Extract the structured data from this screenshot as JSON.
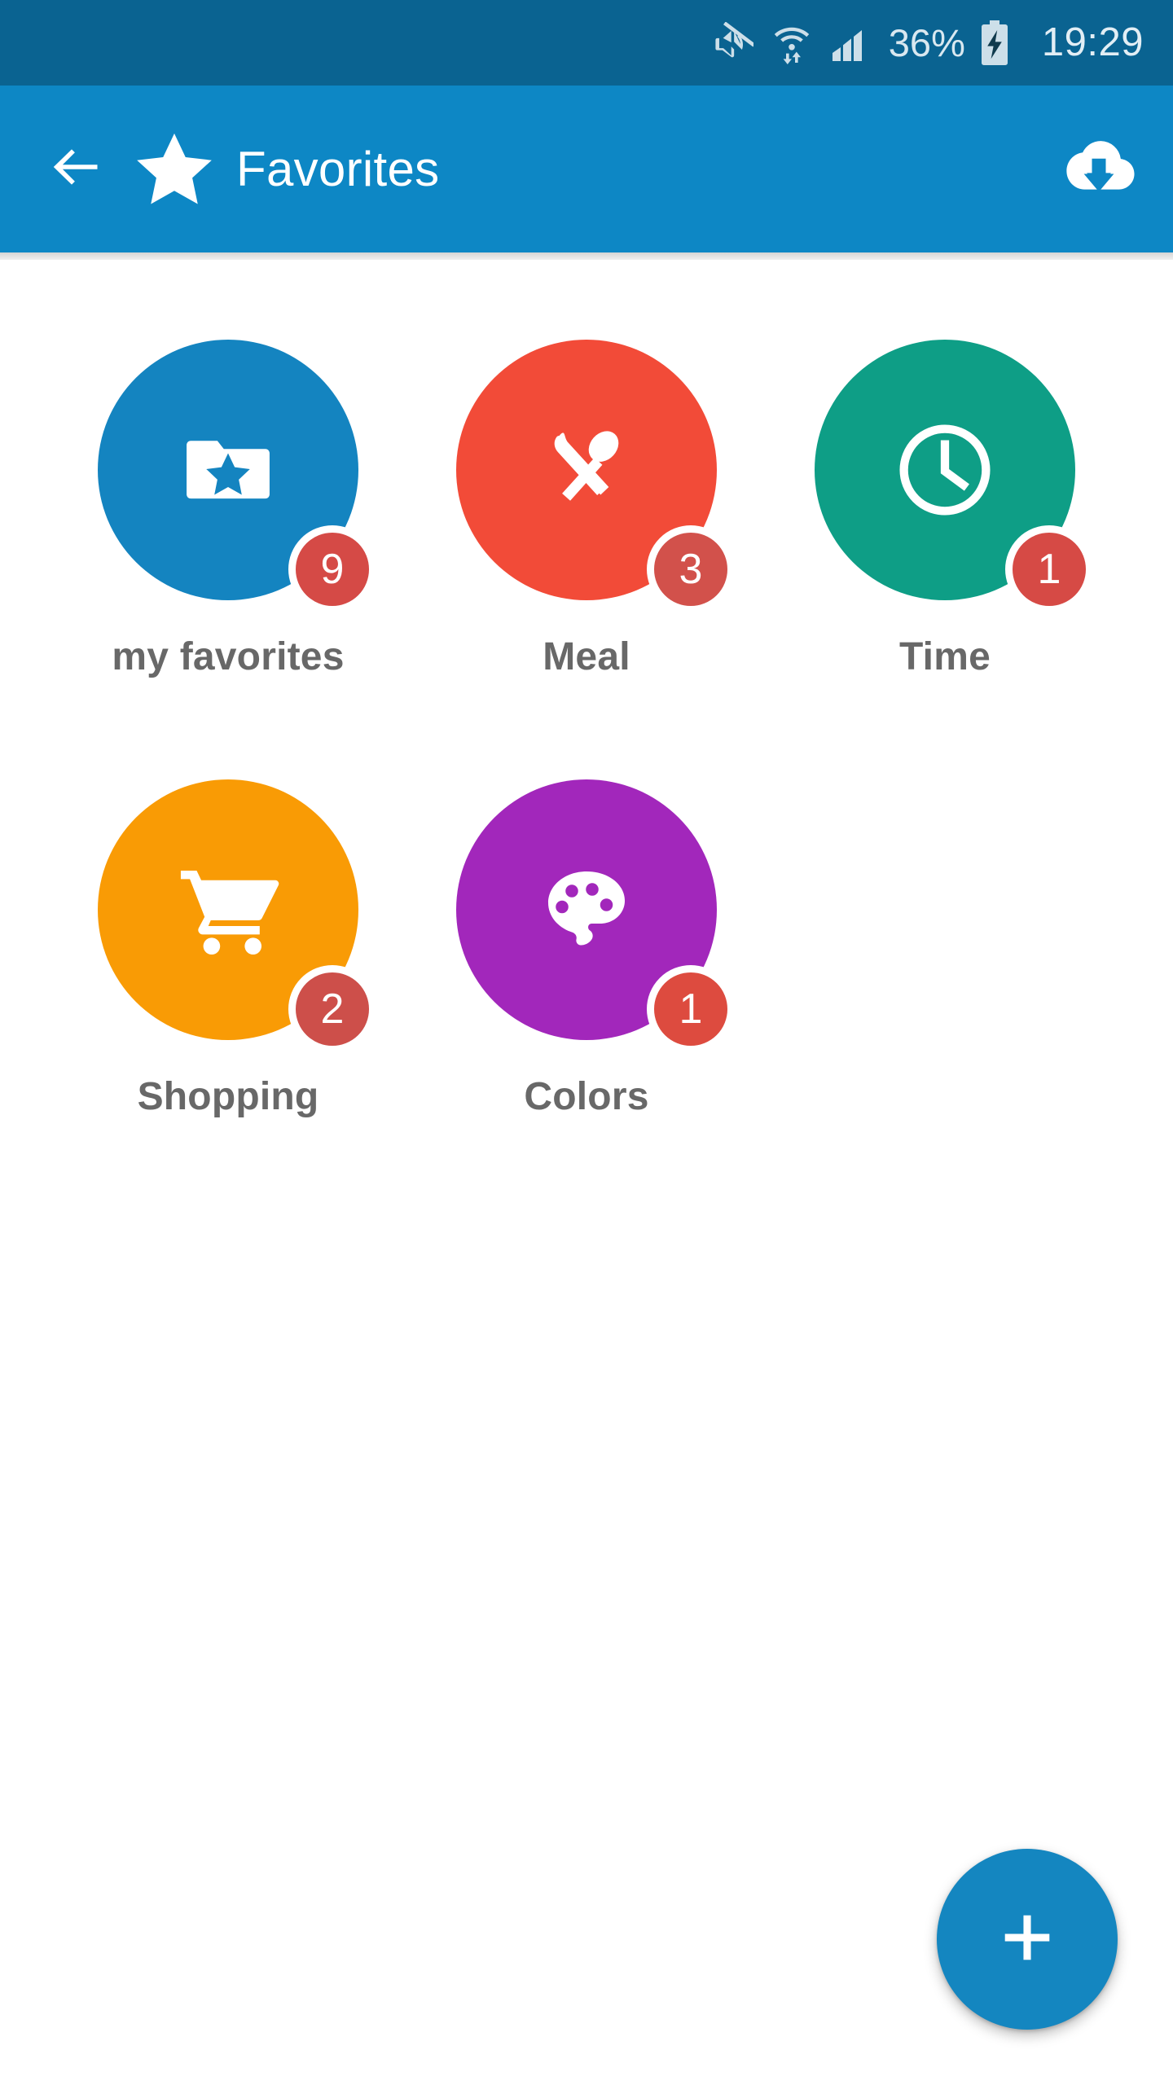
{
  "status_bar": {
    "background": "#0a6391",
    "mute_icon": "mute-icon",
    "wifi_icon": "wifi-transfer-icon",
    "signal_icon": "signal-bars-icon",
    "battery_percent": "36%",
    "battery_icon": "battery-charging-icon",
    "clock": "19:29"
  },
  "app_bar": {
    "background": "#0d87c5",
    "back_icon": "back-arrow-icon",
    "star_icon": "star-icon",
    "title": "Favorites",
    "download_icon": "cloud-download-icon"
  },
  "grid": {
    "items": [
      {
        "label": "my favorites",
        "badge": "9",
        "color": "#1484c0",
        "badge_color": "#d54a46",
        "icon": "folder-star-icon"
      },
      {
        "label": "Meal",
        "badge": "3",
        "color": "#f24b38",
        "badge_color": "#d2514b",
        "icon": "knife-spoon-icon"
      },
      {
        "label": "Time",
        "badge": "1",
        "color": "#0e9e86",
        "badge_color": "#d64a45",
        "icon": "clock-icon"
      },
      {
        "label": "Shopping",
        "badge": "2",
        "color": "#f99b05",
        "badge_color": "#cd4f4a",
        "icon": "shopping-cart-icon"
      },
      {
        "label": "Colors",
        "badge": "1",
        "color": "#a227bb",
        "badge_color": "#dd4b3f",
        "icon": "palette-icon"
      }
    ]
  },
  "fab": {
    "icon": "plus-icon",
    "color": "#1486c0"
  }
}
